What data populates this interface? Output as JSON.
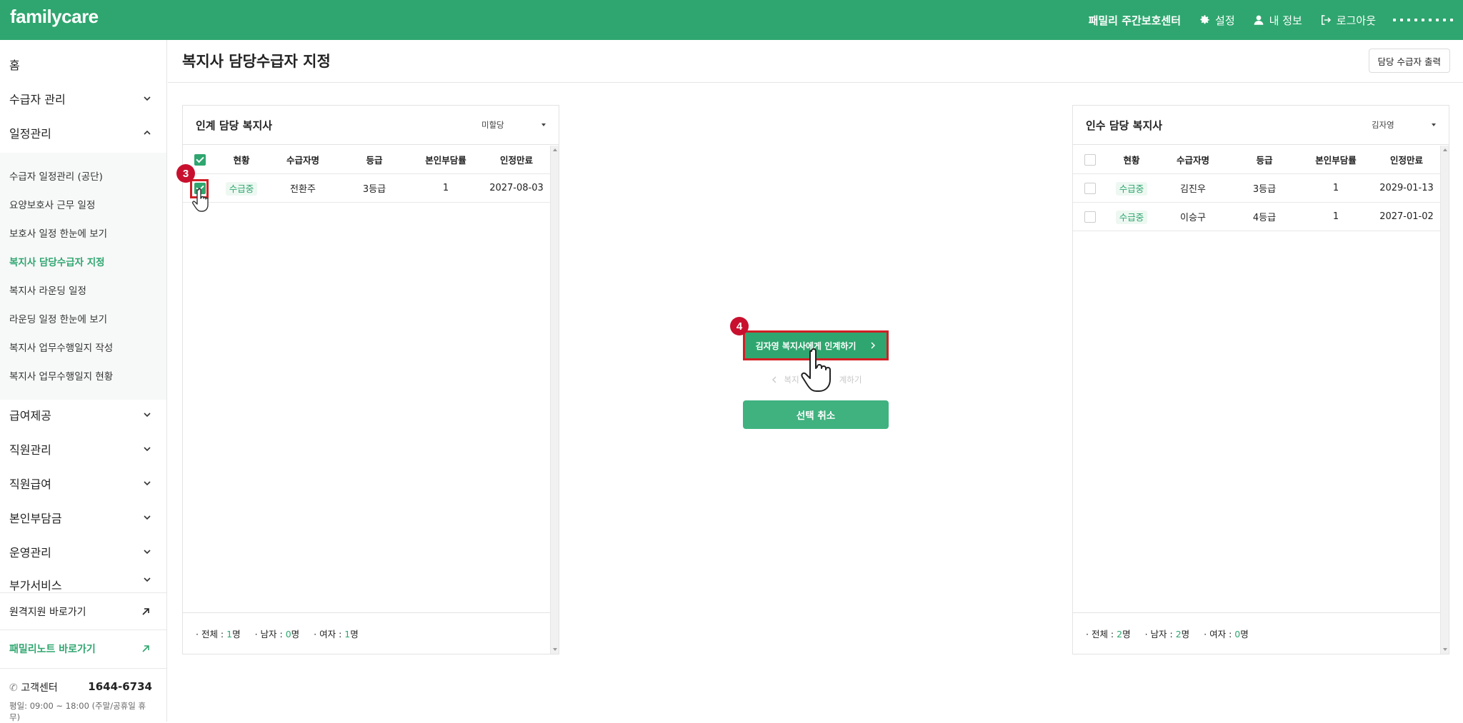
{
  "app": {
    "logo": "familycare",
    "center_name": "패밀리 주간보호센터",
    "settings": "설정",
    "my_info": "내 정보",
    "logout": "로그아웃"
  },
  "sidebar": {
    "home": "홈",
    "menus": [
      {
        "label": "수급자 관리"
      },
      {
        "label": "일정관리"
      }
    ],
    "submenu": [
      {
        "label": "수급자 일정관리 (공단)"
      },
      {
        "label": "요양보호사 근무 일정"
      },
      {
        "label": "보호사 일정 한눈에 보기"
      },
      {
        "label": "복지사 담당수급자 지정"
      },
      {
        "label": "복지사 라운딩 일정"
      },
      {
        "label": "라운딩 일정 한눈에 보기"
      },
      {
        "label": "복지사 업무수행일지 작성"
      },
      {
        "label": "복지사 업무수행일지 현황"
      }
    ],
    "menus_after": [
      {
        "label": "급여제공"
      },
      {
        "label": "직원관리"
      },
      {
        "label": "직원급여"
      },
      {
        "label": "본인부담금"
      },
      {
        "label": "운영관리"
      },
      {
        "label": "부가서비스"
      }
    ],
    "remote_link": "원격지원 바로가기",
    "familynote_link": "패밀리노트 바로가기",
    "cs_label": "고객센터",
    "cs_phone": "1644-6734",
    "cs_hours": "평일: 09:00 ~ 18:00 (주말/공휴일 휴무)"
  },
  "page": {
    "title": "복지사 담당수급자 지정",
    "print_button": "담당 수급자 출력"
  },
  "left_panel": {
    "title": "인계 담당 복지사",
    "select_value": "미할당",
    "columns": [
      "현황",
      "수급자명",
      "등급",
      "본인부담률",
      "인정만료"
    ],
    "rows": [
      {
        "status": "수급중",
        "name": "전환주",
        "grade": "3등급",
        "rate": "1",
        "expiry": "2027-08-03"
      }
    ],
    "footer": {
      "total_label": "· 전체 : ",
      "total": "1",
      "total_unit": "명",
      "male_label": "· 남자 : ",
      "male": "0",
      "male_unit": "명",
      "female_label": "· 여자 : ",
      "female": "1",
      "female_unit": "명"
    }
  },
  "right_panel": {
    "title": "인수 담당 복지사",
    "select_value": "김자영",
    "columns": [
      "현황",
      "수급자명",
      "등급",
      "본인부담률",
      "인정만료"
    ],
    "rows": [
      {
        "status": "수급중",
        "name": "김진우",
        "grade": "3등급",
        "rate": "1",
        "expiry": "2029-01-13"
      },
      {
        "status": "수급중",
        "name": "이승구",
        "grade": "4등급",
        "rate": "1",
        "expiry": "2027-01-02"
      }
    ],
    "footer": {
      "total_label": "· 전체 : ",
      "total": "2",
      "total_unit": "명",
      "male_label": "· 남자 : ",
      "male": "2",
      "male_unit": "명",
      "female_label": "· 여자 : ",
      "female": "0",
      "female_unit": "명"
    }
  },
  "actions": {
    "transfer": "김자영 복지사에게 인계하기",
    "return_left": "복지",
    "return_right": "계하기",
    "cancel": "선택 취소"
  },
  "annotations": {
    "step3": "3",
    "step4": "4"
  },
  "colors": {
    "brand": "#2fa66f",
    "highlight": "#d11f24",
    "badge": "#c8102e"
  }
}
